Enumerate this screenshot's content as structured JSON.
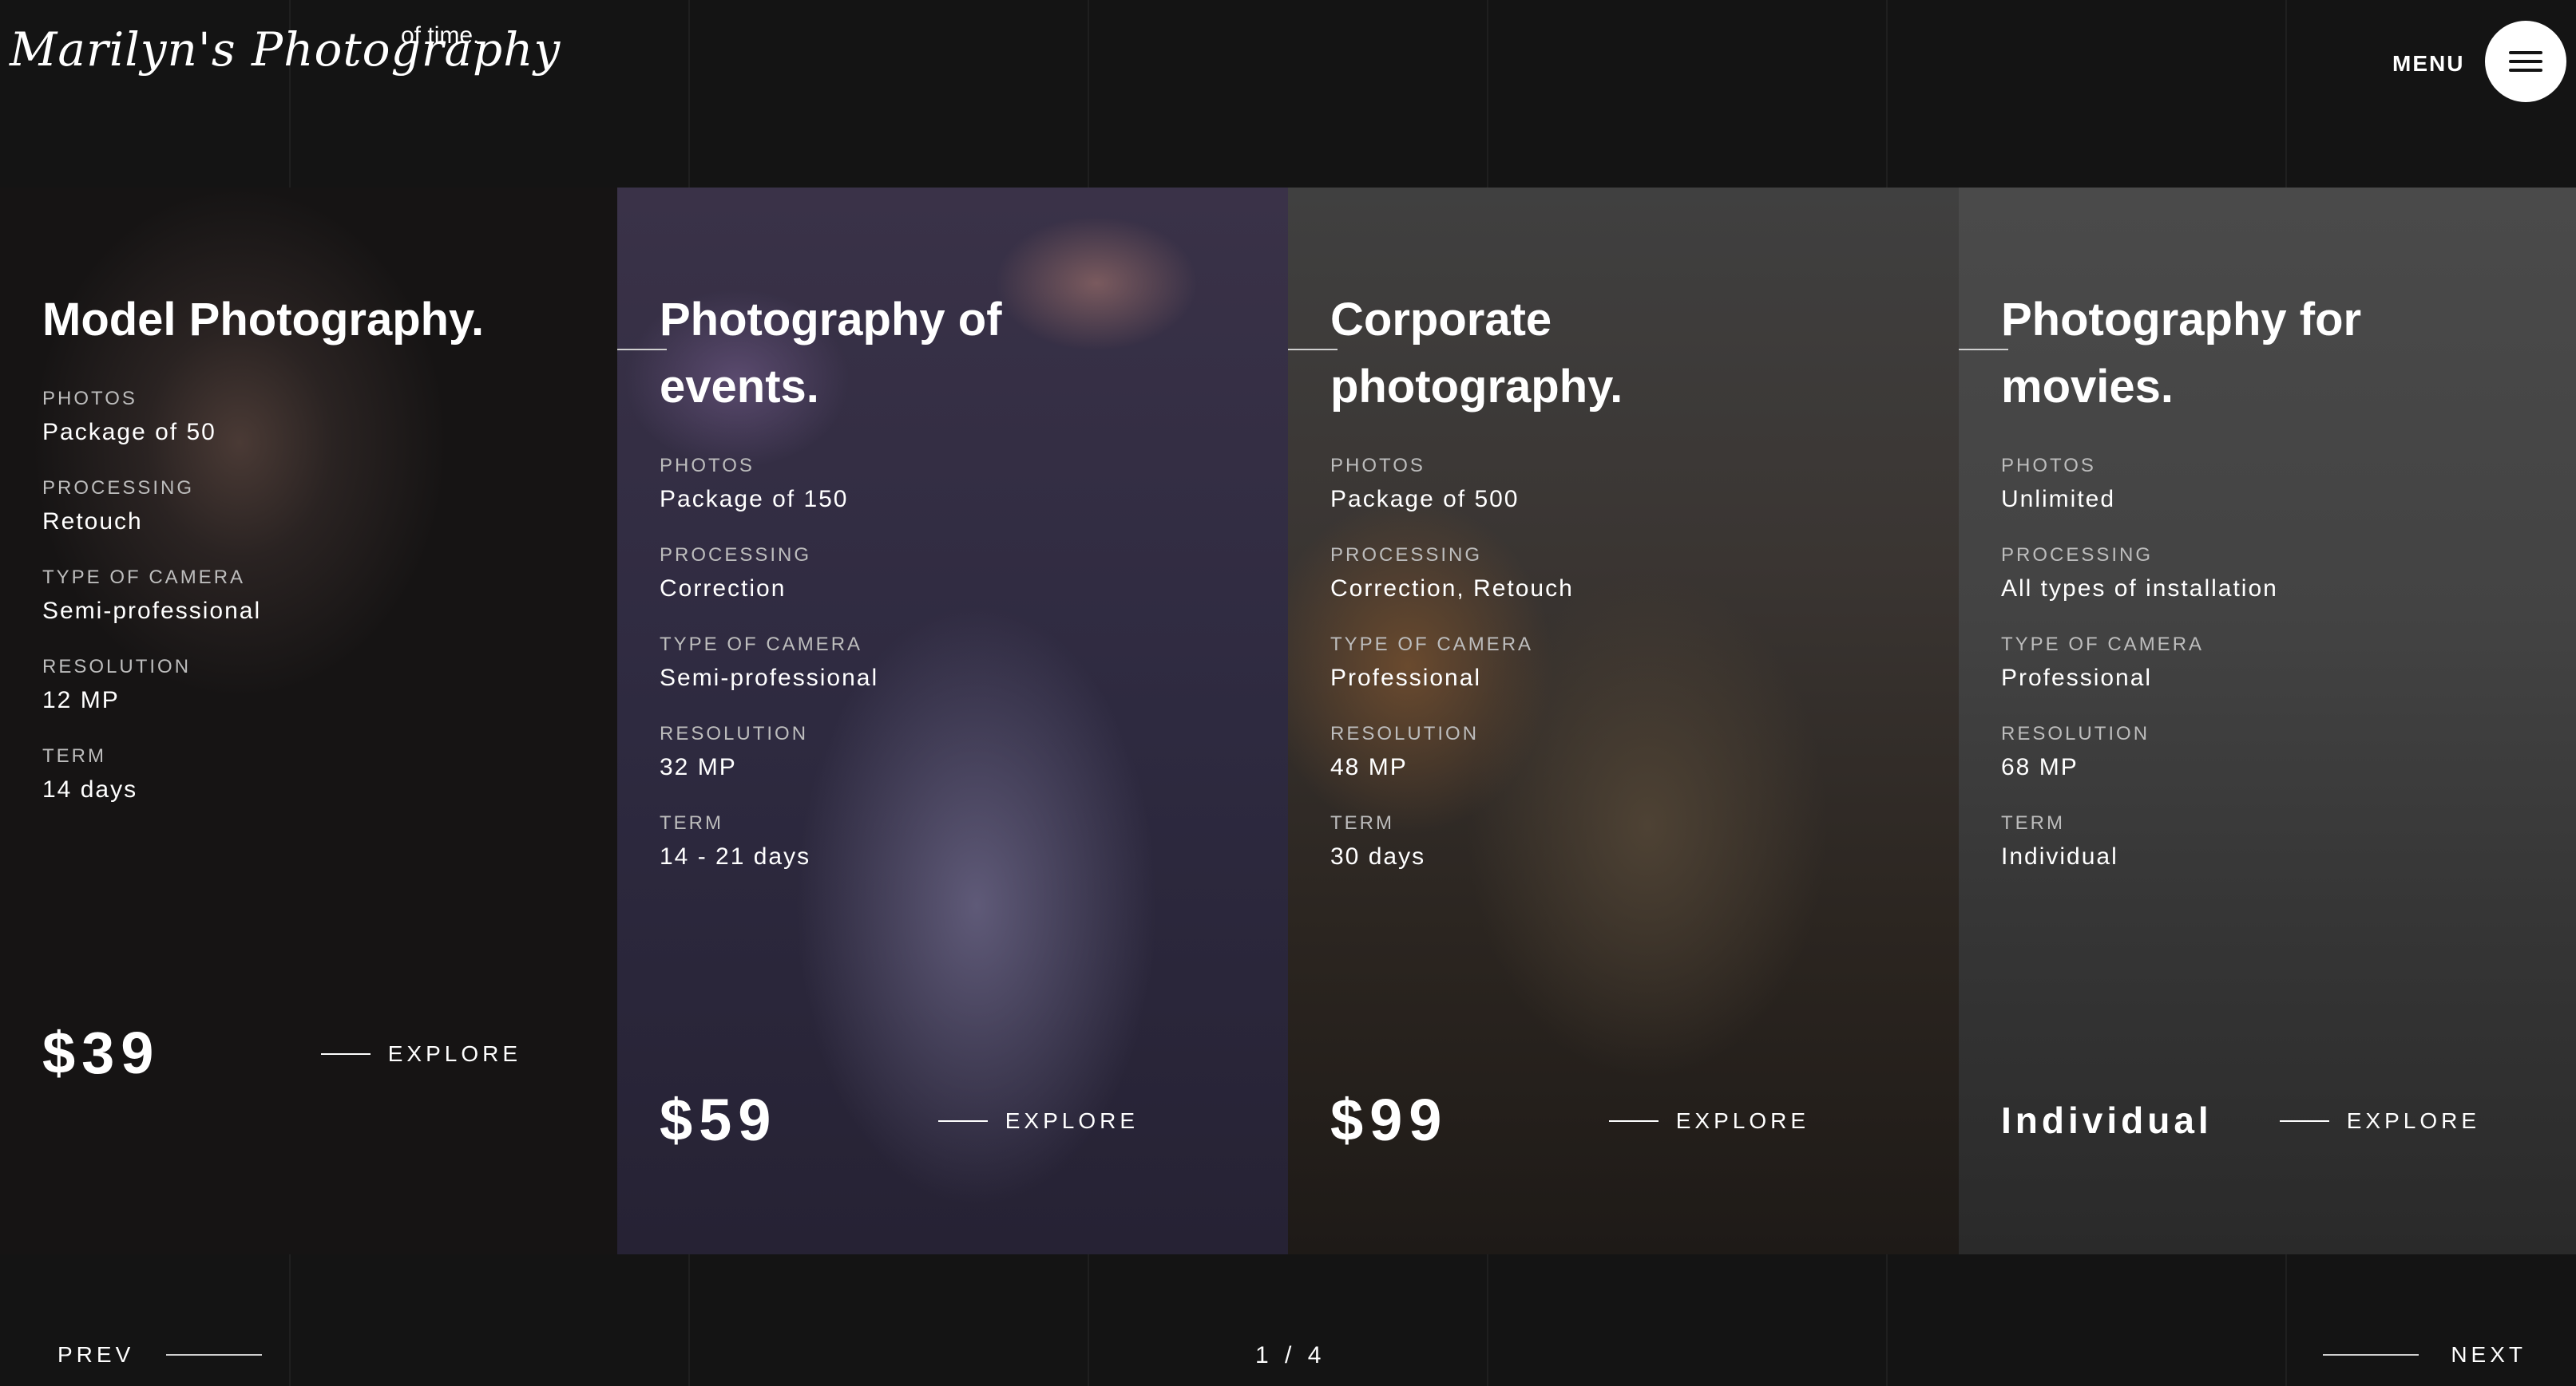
{
  "logo": {
    "script": "Marilyn's Photography",
    "tagline": "of time."
  },
  "header": {
    "menu_label": "MENU",
    "menu_icon": "hamburger-icon"
  },
  "cards": [
    {
      "title": "Model Photography.",
      "specs": [
        {
          "label": "PHOTOS",
          "value": "Package of 50"
        },
        {
          "label": "PROCESSING",
          "value": "Retouch"
        },
        {
          "label": "TYPE OF CAMERA",
          "value": "Semi-professional"
        },
        {
          "label": "RESOLUTION",
          "value": "12 MP"
        },
        {
          "label": "TERM",
          "value": "14 days"
        }
      ],
      "price": "$39",
      "explore_label": "EXPLORE"
    },
    {
      "title": "Photography of events.",
      "specs": [
        {
          "label": "PHOTOS",
          "value": "Package of 150"
        },
        {
          "label": "PROCESSING",
          "value": "Correction"
        },
        {
          "label": "TYPE OF CAMERA",
          "value": "Semi-professional"
        },
        {
          "label": "RESOLUTION",
          "value": "32 MP"
        },
        {
          "label": "TERM",
          "value": "14 - 21 days"
        }
      ],
      "price": "$59",
      "explore_label": "EXPLORE"
    },
    {
      "title": "Corporate photography.",
      "specs": [
        {
          "label": "PHOTOS",
          "value": "Package of 500"
        },
        {
          "label": "PROCESSING",
          "value": "Correction, Retouch"
        },
        {
          "label": "TYPE OF CAMERA",
          "value": "Professional"
        },
        {
          "label": "RESOLUTION",
          "value": "48 MP"
        },
        {
          "label": "TERM",
          "value": "30 days"
        }
      ],
      "price": "$99",
      "explore_label": "EXPLORE"
    },
    {
      "title": "Photography for movies.",
      "specs": [
        {
          "label": "PHOTOS",
          "value": "Unlimited"
        },
        {
          "label": "PROCESSING",
          "value": "All types of installation"
        },
        {
          "label": "TYPE OF CAMERA",
          "value": "Professional"
        },
        {
          "label": "RESOLUTION",
          "value": "68 MP"
        },
        {
          "label": "TERM",
          "value": "Individual"
        }
      ],
      "price": "Individual",
      "explore_label": "EXPLORE"
    }
  ],
  "pager": {
    "prev_label": "PREV",
    "next_label": "NEXT",
    "page_indicator": "1 / 4"
  },
  "colors": {
    "background": "#141414",
    "accent": "#ffffff",
    "muted_text": "#bdbdbd"
  }
}
